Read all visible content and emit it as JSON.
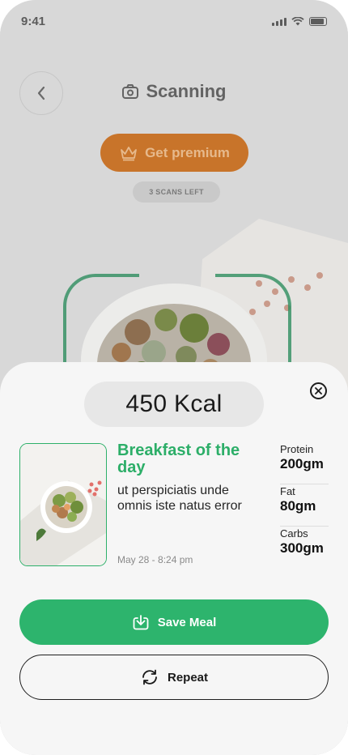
{
  "status_bar": {
    "time": "9:41"
  },
  "header": {
    "title": "Scanning"
  },
  "premium": {
    "label": "Get premium"
  },
  "scans": {
    "left_label": "3 SCANS LEFT"
  },
  "sheet": {
    "calories": "450 Kcal",
    "meal": {
      "title": "Breakfast of the day",
      "description": "ut perspiciatis unde omnis iste natus error",
      "date": "May 28 - 8:24 pm"
    },
    "macros": [
      {
        "label": "Protein",
        "value": "200gm"
      },
      {
        "label": "Fat",
        "value": "80gm"
      },
      {
        "label": "Carbs",
        "value": "300gm"
      }
    ],
    "save_label": "Save Meal",
    "repeat_label": "Repeat"
  },
  "colors": {
    "accent_green": "#2db46d",
    "premium_orange": "#c8742a"
  },
  "icons": [
    "back-arrow-icon",
    "camera-icon",
    "crown-icon",
    "close-icon",
    "download-icon",
    "repeat-icon"
  ]
}
